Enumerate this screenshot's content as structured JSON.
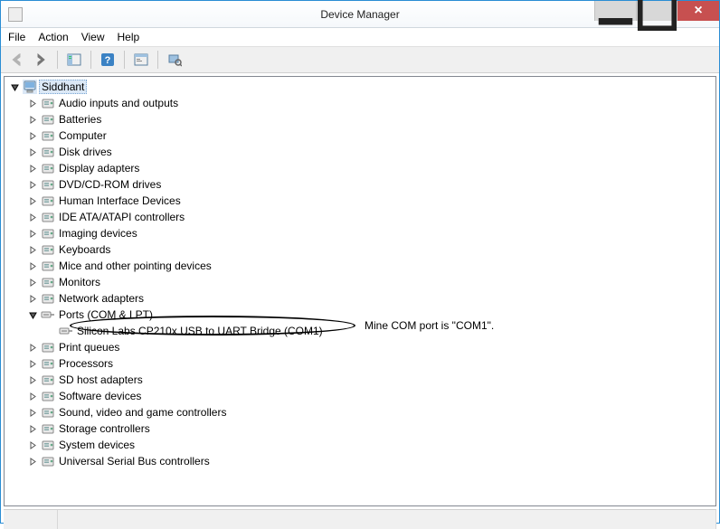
{
  "window": {
    "title": "Device Manager"
  },
  "menu": {
    "file": "File",
    "action": "Action",
    "view": "View",
    "help": "Help"
  },
  "tree": {
    "root": "Siddhant",
    "categories": [
      {
        "label": "Audio inputs and outputs",
        "expanded": false,
        "hasChildren": true
      },
      {
        "label": "Batteries",
        "expanded": false,
        "hasChildren": true
      },
      {
        "label": "Computer",
        "expanded": false,
        "hasChildren": true
      },
      {
        "label": "Disk drives",
        "expanded": false,
        "hasChildren": true
      },
      {
        "label": "Display adapters",
        "expanded": false,
        "hasChildren": true
      },
      {
        "label": "DVD/CD-ROM drives",
        "expanded": false,
        "hasChildren": true
      },
      {
        "label": "Human Interface Devices",
        "expanded": false,
        "hasChildren": true
      },
      {
        "label": "IDE ATA/ATAPI controllers",
        "expanded": false,
        "hasChildren": true
      },
      {
        "label": "Imaging devices",
        "expanded": false,
        "hasChildren": true
      },
      {
        "label": "Keyboards",
        "expanded": false,
        "hasChildren": true
      },
      {
        "label": "Mice and other pointing devices",
        "expanded": false,
        "hasChildren": true
      },
      {
        "label": "Monitors",
        "expanded": false,
        "hasChildren": true
      },
      {
        "label": "Network adapters",
        "expanded": false,
        "hasChildren": true
      },
      {
        "label": "Ports (COM & LPT)",
        "expanded": true,
        "hasChildren": true,
        "children": [
          {
            "label": "Silicon Labs CP210x USB to UART Bridge (COM1)"
          }
        ]
      },
      {
        "label": "Print queues",
        "expanded": false,
        "hasChildren": true
      },
      {
        "label": "Processors",
        "expanded": false,
        "hasChildren": true
      },
      {
        "label": "SD host adapters",
        "expanded": false,
        "hasChildren": true
      },
      {
        "label": "Software devices",
        "expanded": false,
        "hasChildren": true
      },
      {
        "label": "Sound, video and game controllers",
        "expanded": false,
        "hasChildren": true
      },
      {
        "label": "Storage controllers",
        "expanded": false,
        "hasChildren": true
      },
      {
        "label": "System devices",
        "expanded": false,
        "hasChildren": true
      },
      {
        "label": "Universal Serial Bus controllers",
        "expanded": false,
        "hasChildren": true
      }
    ]
  },
  "annotation": {
    "text": "Mine COM port is \"COM1\"."
  }
}
